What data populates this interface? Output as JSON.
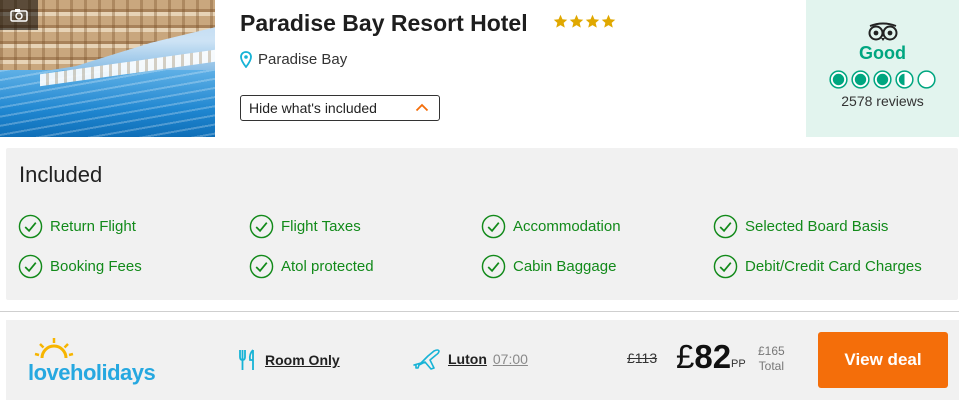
{
  "hotel": {
    "name": "Paradise Bay Resort Hotel",
    "star_rating": 4,
    "location": "Paradise Bay",
    "photo_icon": "camera-icon",
    "toggle_label": "Hide what's included"
  },
  "review": {
    "provider_icon": "tripadvisor-owl-icon",
    "rating_word": "Good",
    "bubble_rating": 3.5,
    "bubble_max": 5,
    "count_text": "2578 reviews"
  },
  "included": {
    "title": "Included",
    "items": [
      "Return Flight",
      "Flight Taxes",
      "Accommodation",
      "Selected Board Basis",
      "Booking Fees",
      "Atol protected",
      "Cabin Baggage",
      "Debit/Credit Card Charges"
    ]
  },
  "deal": {
    "brand": "loveholidays",
    "board": "Room Only",
    "board_icon": "cutlery-icon",
    "airport": "Luton",
    "departure_time": "07:00",
    "flight_icon": "plane-icon",
    "old_price": "£113",
    "currency": "£",
    "price": "82",
    "per_person": "PP",
    "total_price": "£165",
    "total_label": "Total",
    "cta": "View deal"
  },
  "colors": {
    "accent_orange": "#f46e0a",
    "tripadvisor_green": "#00a680",
    "included_green": "#128a1a",
    "brand_blue": "#26a8e0",
    "star_gold": "#e0a800"
  }
}
